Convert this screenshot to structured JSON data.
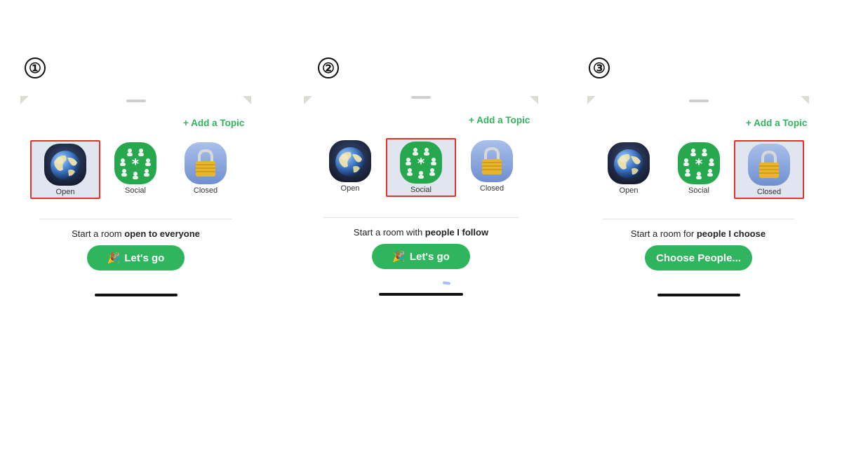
{
  "steps": [
    {
      "number": "①",
      "add_topic": "+ Add a Topic",
      "options": [
        {
          "label": "Open",
          "icon": "globe-icon",
          "selected": true
        },
        {
          "label": "Social",
          "icon": "people-icon",
          "selected": false
        },
        {
          "label": "Closed",
          "icon": "lock-icon",
          "selected": false
        }
      ],
      "description": {
        "prefix": "Start a room ",
        "emphasis": "open to everyone"
      },
      "button": {
        "emoji": "🎉",
        "label": "Let's go"
      }
    },
    {
      "number": "②",
      "add_topic": "+ Add a Topic",
      "options": [
        {
          "label": "Open",
          "icon": "globe-icon",
          "selected": false
        },
        {
          "label": "Social",
          "icon": "people-icon",
          "selected": true
        },
        {
          "label": "Closed",
          "icon": "lock-icon",
          "selected": false
        }
      ],
      "description": {
        "prefix": "Start a room with ",
        "emphasis": "people I follow"
      },
      "button": {
        "emoji": "🎉",
        "label": "Let's go"
      }
    },
    {
      "number": "③",
      "add_topic": "+ Add a Topic",
      "options": [
        {
          "label": "Open",
          "icon": "globe-icon",
          "selected": false
        },
        {
          "label": "Social",
          "icon": "people-icon",
          "selected": false
        },
        {
          "label": "Closed",
          "icon": "lock-icon",
          "selected": true
        }
      ],
      "description": {
        "prefix": "Start a room for ",
        "emphasis": "people I choose"
      },
      "button": {
        "emoji": "",
        "label": "Choose People..."
      }
    }
  ],
  "colors": {
    "accent_green": "#2fb55d",
    "selection_border": "#e0342a",
    "selection_fill": "#e1e5f0"
  }
}
